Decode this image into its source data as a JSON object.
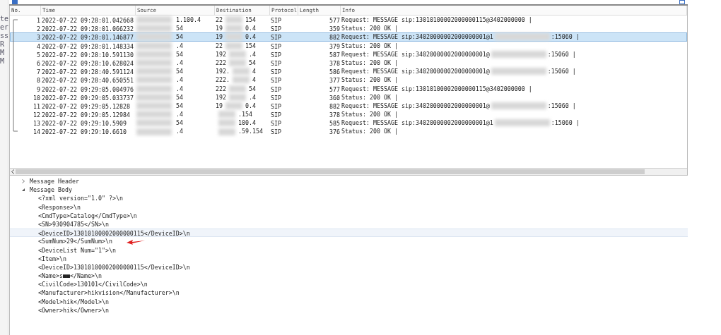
{
  "left_strip": [
    "te",
    "er",
    "ss",
    "R",
    "M",
    "M"
  ],
  "packet_list": {
    "columns": [
      "No.",
      "Time",
      "Source",
      "Destination",
      "Protocol",
      "Length",
      "Info"
    ],
    "rows": [
      {
        "no": "1",
        "time": "2022-07-22 09:28:01.042668",
        "source": "1.100.4",
        "dest_start": "22",
        "dest_end": "154",
        "protocol": "SIP",
        "length": "577",
        "info": "Request: MESSAGE sip:13010100002000000115@3402000000 |",
        "selected": false
      },
      {
        "no": "2",
        "time": "2022-07-22 09:28:01.066232",
        "source": "54",
        "dest_start": "19",
        "dest_end": "0.4",
        "protocol": "SIP",
        "length": "359",
        "info": "Status: 200 OK |",
        "selected": false
      },
      {
        "no": "3",
        "time": "2022-07-22 09:28:01.146877",
        "source": "54",
        "dest_start": "19",
        "dest_end": "0.4",
        "protocol": "SIP",
        "length": "882",
        "info": "Request: MESSAGE sip:34020000002000000001@1",
        "info_tail": ":15060 |",
        "selected": true
      },
      {
        "no": "4",
        "time": "2022-07-22 09:28:01.148334",
        "source": ".4",
        "dest_start": "22",
        "dest_end": "154",
        "protocol": "SIP",
        "length": "379",
        "info": "Status: 200 OK |",
        "selected": false
      },
      {
        "no": "5",
        "time": "2022-07-22 09:28:10.591130",
        "source": "54",
        "dest_start": "192",
        "dest_end": ".4",
        "protocol": "SIP",
        "length": "587",
        "info": "Request: MESSAGE sip:34020000002000000001@",
        "info_tail": ":15060 |",
        "selected": false
      },
      {
        "no": "6",
        "time": "2022-07-22 09:28:10.628024",
        "source": ".4",
        "dest_start": "222",
        "dest_end": "54",
        "protocol": "SIP",
        "length": "378",
        "info": "Status: 200 OK |",
        "selected": false
      },
      {
        "no": "7",
        "time": "2022-07-22 09:28:40.591124",
        "source": "54",
        "dest_start": "192.",
        "dest_end": "4",
        "protocol": "SIP",
        "length": "586",
        "info": "Request: MESSAGE sip:34020000002000000001@",
        "info_tail": ":15060 |",
        "selected": false
      },
      {
        "no": "8",
        "time": "2022-07-22 09:28:40.650551",
        "source": ".4",
        "dest_start": "222.",
        "dest_end": "4",
        "protocol": "SIP",
        "length": "377",
        "info": "Status: 200 OK |",
        "selected": false
      },
      {
        "no": "9",
        "time": "2022-07-22 09:29:05.004976",
        "source": ".4",
        "dest_start": "222",
        "dest_end": "54",
        "protocol": "SIP",
        "length": "577",
        "info": "Request: MESSAGE sip:13010100002000000115@3402000000 |",
        "selected": false
      },
      {
        "no": "10",
        "time": "2022-07-22 09:29:05.033737",
        "source": "54",
        "dest_start": "192",
        "dest_end": ".4",
        "protocol": "SIP",
        "length": "360",
        "info": "Status: 200 OK |",
        "selected": false
      },
      {
        "no": "11",
        "time": "2022-07-22 09:29:05.12828",
        "source": "54",
        "dest_start": "19",
        "dest_end": "0.4",
        "protocol": "SIP",
        "length": "882",
        "info": "Request: MESSAGE sip:34020000002000000001@",
        "info_tail": ":15060 |",
        "selected": false
      },
      {
        "no": "12",
        "time": "2022-07-22 09:29:05.12984",
        "source": ".4",
        "dest_end": ".154",
        "protocol": "SIP",
        "length": "378",
        "info": "Status: 200 OK |",
        "selected": false
      },
      {
        "no": "13",
        "time": "2022-07-22 09:29:10.5909",
        "source": "54",
        "dest_end": "100.4",
        "protocol": "SIP",
        "length": "585",
        "info": "Request: MESSAGE sip:34020000002000000001@1",
        "info_tail": ":15060 |",
        "selected": false
      },
      {
        "no": "14",
        "time": "2022-07-22 09:29:10.6610",
        "source": ".4",
        "dest_end": ".59.154",
        "protocol": "SIP",
        "length": "376",
        "info": "Status: 200 OK |",
        "selected": false
      }
    ]
  },
  "details": [
    {
      "label": "Message Header",
      "expanded": false
    },
    {
      "label": "Message Body",
      "expanded": true,
      "children": [
        {
          "label": "<?xml version=\"1.0\" ?>\\n",
          "selected": false
        },
        {
          "label": "<Response>\\n",
          "selected": false
        },
        {
          "label": "<CmdType>Catalog</CmdType>\\n",
          "selected": false
        },
        {
          "label": "<SN>930904785</SN>\\n",
          "selected": false
        },
        {
          "label": "<DeviceID>13010100002000000115</DeviceID>\\n",
          "selected": true
        },
        {
          "label": "<SumNum>29</SumNum>\\n",
          "selected": false
        },
        {
          "label": "<DeviceList Num=\"1\">\\n",
          "selected": false
        },
        {
          "label": "<Item>\\n",
          "selected": false
        },
        {
          "label": "<DeviceID>13010100002000000115</DeviceID>\\n",
          "selected": false
        },
        {
          "label": "<Name>s■■</Name>\\n",
          "selected": false
        },
        {
          "label": "<CivilCode>130101</CivilCode>\\n",
          "selected": false
        },
        {
          "label": "<Manufacturer>hikvision</Manufacturer>\\n",
          "selected": false
        },
        {
          "label": "<Model>hik</Model>\\n",
          "selected": false
        },
        {
          "label": "<Owner>hik</Owner>\\n",
          "selected": false
        }
      ]
    }
  ]
}
